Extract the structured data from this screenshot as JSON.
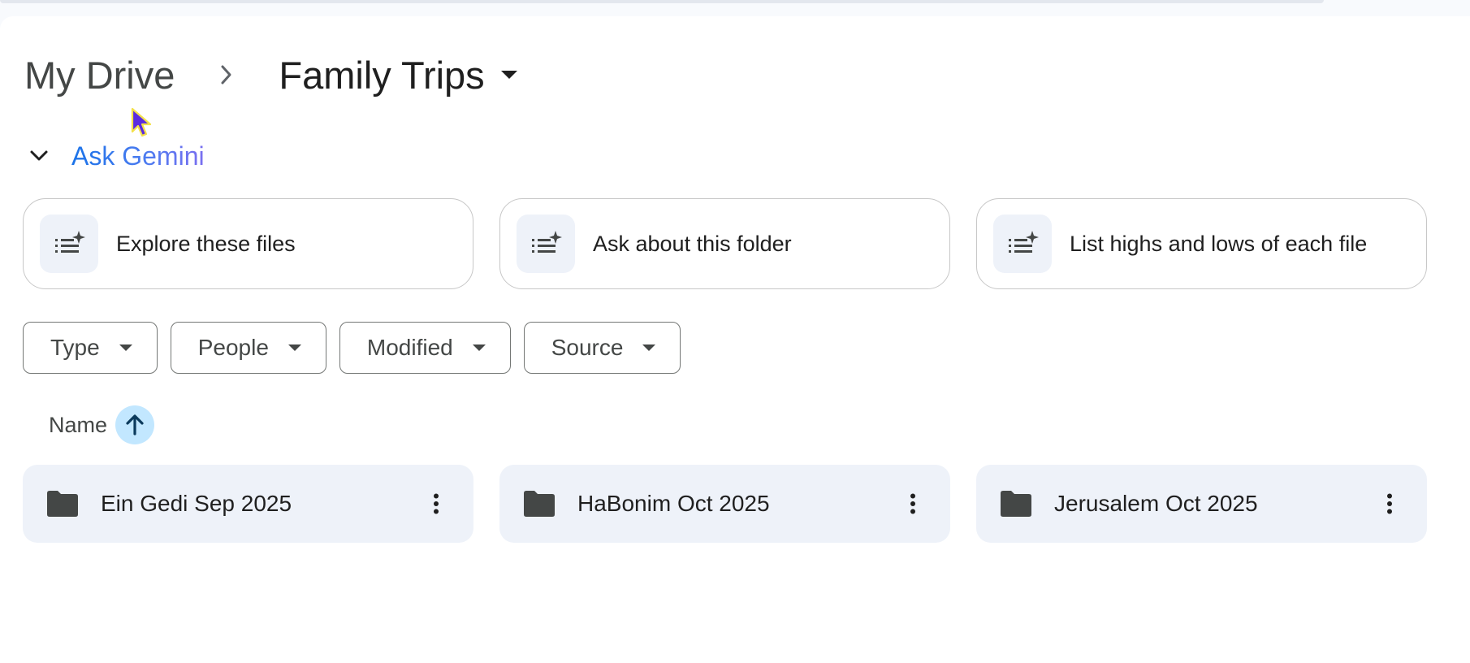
{
  "breadcrumb": {
    "root": "My Drive",
    "separator_icon": "chevron-right-icon",
    "current": "Family Trips",
    "current_icon": "caret-down-icon"
  },
  "gemini": {
    "label": "Ask Gemini",
    "toggle_icon": "chevron-down-icon",
    "suggestions": [
      {
        "label": "Explore these files",
        "icon": "summarize-sparkle-icon"
      },
      {
        "label": "Ask about this folder",
        "icon": "summarize-sparkle-icon"
      },
      {
        "label": "List highs and lows of each file",
        "icon": "summarize-sparkle-icon"
      }
    ]
  },
  "filters": [
    {
      "label": "Type",
      "icon": "caret-down-icon"
    },
    {
      "label": "People",
      "icon": "caret-down-icon"
    },
    {
      "label": "Modified",
      "icon": "caret-down-icon"
    },
    {
      "label": "Source",
      "icon": "caret-down-icon"
    }
  ],
  "sort": {
    "label": "Name",
    "icon": "arrow-up-icon"
  },
  "folders": [
    {
      "name": "Ein Gedi Sep 2025",
      "icon": "folder-icon",
      "menu_icon": "more-vert-icon"
    },
    {
      "name": "HaBonim Oct 2025",
      "icon": "folder-icon",
      "menu_icon": "more-vert-icon"
    },
    {
      "name": "Jerusalem Oct 2025",
      "icon": "folder-icon",
      "menu_icon": "more-vert-icon"
    }
  ],
  "colors": {
    "page_background": "#ffffff",
    "tile_background": "#eef2f9",
    "sort_active": "#c2e7ff",
    "gemini_gradient_start": "#1a73e8",
    "gemini_gradient_end": "#7a6ff0"
  }
}
